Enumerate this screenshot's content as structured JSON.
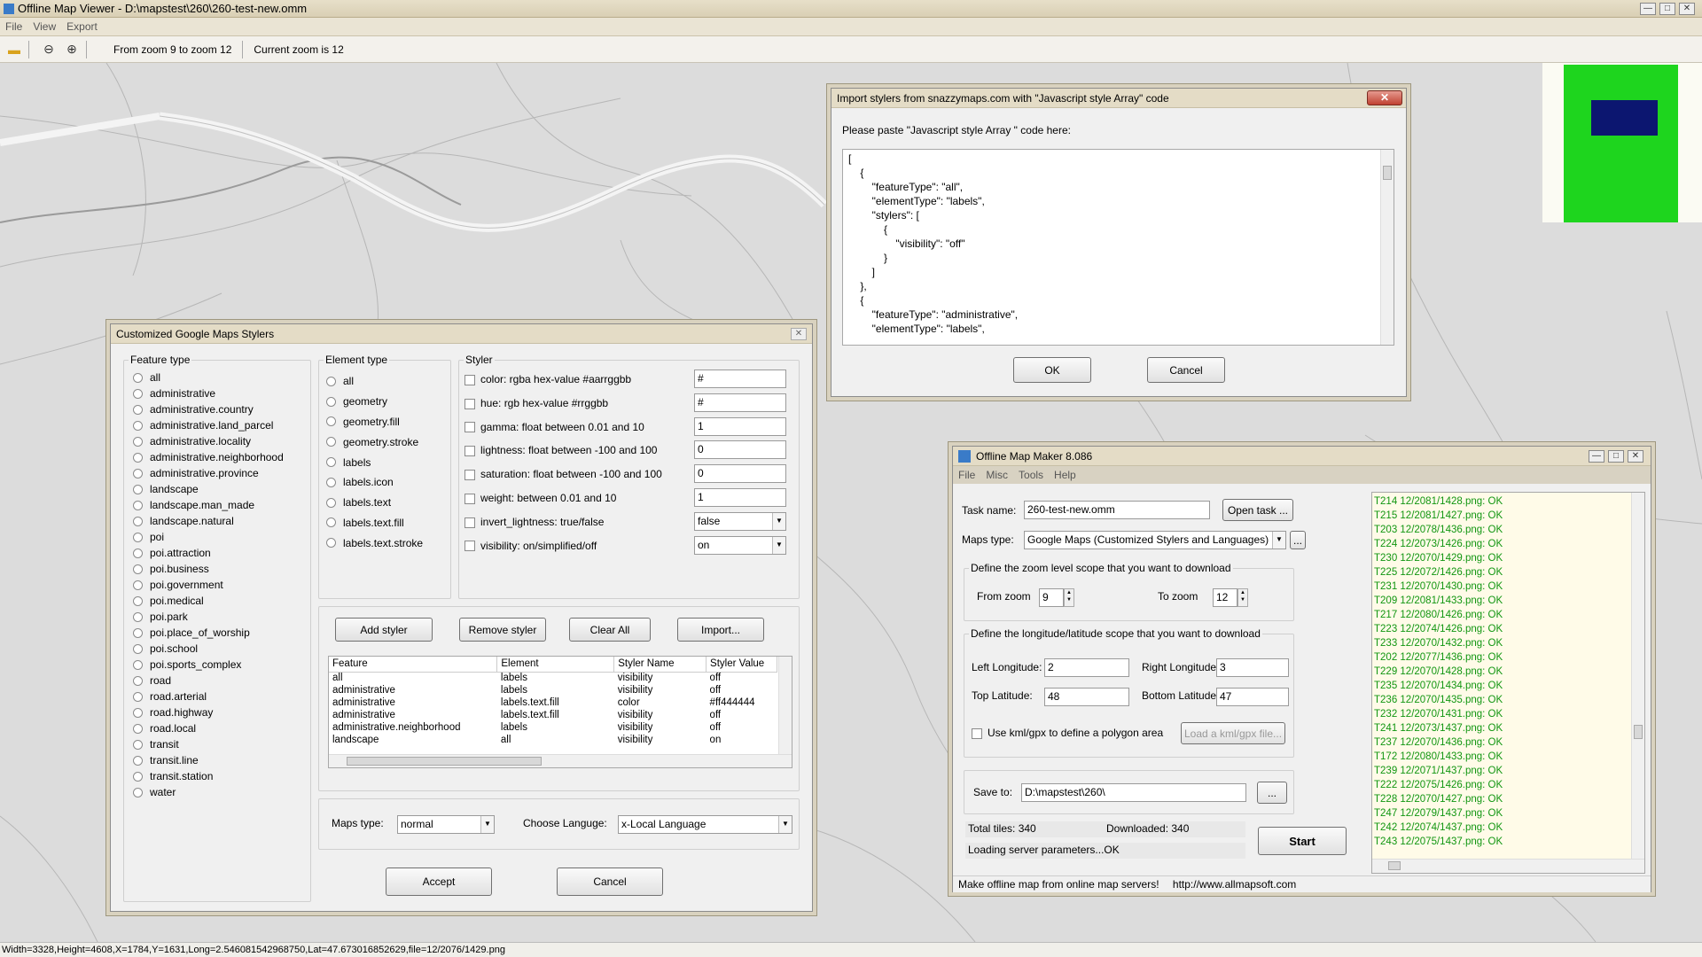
{
  "window": {
    "title": "Offline Map Viewer - D:\\mapstest\\260\\260-test-new.omm"
  },
  "menu": [
    "File",
    "View",
    "Export"
  ],
  "toolbar": {
    "zoom_range": "From zoom 9 to zoom 12",
    "current_zoom": "Current zoom is 12"
  },
  "statusbar": "Width=3328,Height=4608,X=1784,Y=1631,Long=2.546081542968750,Lat=47.673016852629,file=12/2076/1429.png",
  "colors": {
    "minimap_bg": "#1ed51e",
    "minimap_view": "#0c1670",
    "log_text": "#119611"
  },
  "import_dialog": {
    "title": "Import stylers from snazzymaps.com with \"Javascript style Array\" code",
    "prompt": "Please paste \"Javascript style Array \" code  here:",
    "code": "[\n    {\n        \"featureType\": \"all\",\n        \"elementType\": \"labels\",\n        \"stylers\": [\n            {\n                \"visibility\": \"off\"\n            }\n        ]\n    },\n    {\n        \"featureType\": \"administrative\",\n        \"elementType\": \"labels\",",
    "ok": "OK",
    "cancel": "Cancel"
  },
  "styler_dialog": {
    "title": "Customized Google Maps Stylers",
    "feature_type_title": "Feature type",
    "feature_types": [
      "all",
      "administrative",
      "administrative.country",
      "administrative.land_parcel",
      "administrative.locality",
      "administrative.neighborhood",
      "administrative.province",
      "landscape",
      "landscape.man_made",
      "landscape.natural",
      "poi",
      "poi.attraction",
      "poi.business",
      "poi.government",
      "poi.medical",
      "poi.park",
      "poi.place_of_worship",
      "poi.school",
      "poi.sports_complex",
      "road",
      "road.arterial",
      "road.highway",
      "road.local",
      "transit",
      "transit.line",
      "transit.station",
      "water"
    ],
    "element_type_title": "Element type",
    "element_types": [
      "all",
      "geometry",
      "geometry.fill",
      "geometry.stroke",
      "labels",
      "labels.icon",
      "labels.text",
      "labels.text.fill",
      "labels.text.stroke"
    ],
    "styler_title": "Styler",
    "stylers": [
      {
        "label": "color: rgba hex-value #aarrggbb",
        "value": "#"
      },
      {
        "label": "hue: rgb hex-value #rrggbb",
        "value": "#"
      },
      {
        "label": "gamma: float between 0.01 and 10",
        "value": "1"
      },
      {
        "label": "lightness: float between -100 and 100",
        "value": "0"
      },
      {
        "label": "saturation: float between -100 and 100",
        "value": "0"
      },
      {
        "label": "weight: between 0.01 and  10",
        "value": "1"
      },
      {
        "label": "invert_lightness: true/false",
        "value": "false"
      },
      {
        "label": "visibility: on/simplified/off",
        "value": "on"
      }
    ],
    "buttons": {
      "add": "Add styler",
      "remove": "Remove styler",
      "clear": "Clear All",
      "import": "Import..."
    },
    "table": {
      "headers": [
        "Feature",
        "Element",
        "Styler Name",
        "Styler Value"
      ],
      "rows": [
        [
          "all",
          "labels",
          "visibility",
          "off"
        ],
        [
          "administrative",
          "labels",
          "visibility",
          "off"
        ],
        [
          "administrative",
          "labels.text.fill",
          "color",
          "#ff444444"
        ],
        [
          "administrative",
          "labels.text.fill",
          "visibility",
          "off"
        ],
        [
          "administrative.neighborhood",
          "labels",
          "visibility",
          "off"
        ],
        [
          "landscape",
          "all",
          "visibility",
          "on"
        ]
      ]
    },
    "maps_type_label": "Maps type:",
    "maps_type_value": "normal",
    "language_label": "Choose Languge:",
    "language_value": "x-Local Language",
    "accept": "Accept",
    "cancel": "Cancel"
  },
  "maker": {
    "title": "Offline Map Maker 8.086",
    "menu": [
      "File",
      "Misc",
      "Tools",
      "Help"
    ],
    "task_name_label": "Task name:",
    "task_name": "260-test-new.omm",
    "open_task": "Open task ...",
    "maps_type_label": "Maps type:",
    "maps_type": "Google Maps (Customized Stylers and Languages)",
    "more": "...",
    "zoom_group": "Define the zoom level scope that you want to download",
    "from_zoom_label": "From zoom",
    "from_zoom": "9",
    "to_zoom_label": "To zoom",
    "to_zoom": "12",
    "lonlat_group": "Define the longitude/latitude scope that you want to download",
    "left_lon_label": "Left Longitude:",
    "left_lon": "2",
    "right_lon_label": "Right Longitude:",
    "right_lon": "3",
    "top_lat_label": "Top Latitude:",
    "top_lat": "48",
    "bottom_lat_label": "Bottom Latitude:",
    "bottom_lat": "47",
    "kml_label": "Use kml/gpx to define a polygon area",
    "kml_button": "Load a kml/gpx file...",
    "save_to_label": "Save to:",
    "save_to": "D:\\mapstest\\260\\",
    "browse": "...",
    "total": "Total tiles: 340",
    "downloaded": "Downloaded: 340",
    "status": "Loading server parameters...OK",
    "start": "Start",
    "footer_text": "Make offline map from online map servers!",
    "footer_url": "http://www.allmapsoft.com",
    "log": [
      "T214 12/2081/1428.png: OK",
      "T215 12/2081/1427.png: OK",
      "T203 12/2078/1436.png: OK",
      "T224 12/2073/1426.png: OK",
      "T230 12/2070/1429.png: OK",
      "T225 12/2072/1426.png: OK",
      "T231 12/2070/1430.png: OK",
      "T209 12/2081/1433.png: OK",
      "T217 12/2080/1426.png: OK",
      "T223 12/2074/1426.png: OK",
      "T233 12/2070/1432.png: OK",
      "T202 12/2077/1436.png: OK",
      "T229 12/2070/1428.png: OK",
      "T235 12/2070/1434.png: OK",
      "T236 12/2070/1435.png: OK",
      "T232 12/2070/1431.png: OK",
      "T241 12/2073/1437.png: OK",
      "T237 12/2070/1436.png: OK",
      "T172 12/2080/1433.png: OK",
      "T239 12/2071/1437.png: OK",
      "T222 12/2075/1426.png: OK",
      "T228 12/2070/1427.png: OK",
      "T247 12/2079/1437.png: OK",
      "T242 12/2074/1437.png: OK",
      "T243 12/2075/1437.png: OK"
    ]
  }
}
